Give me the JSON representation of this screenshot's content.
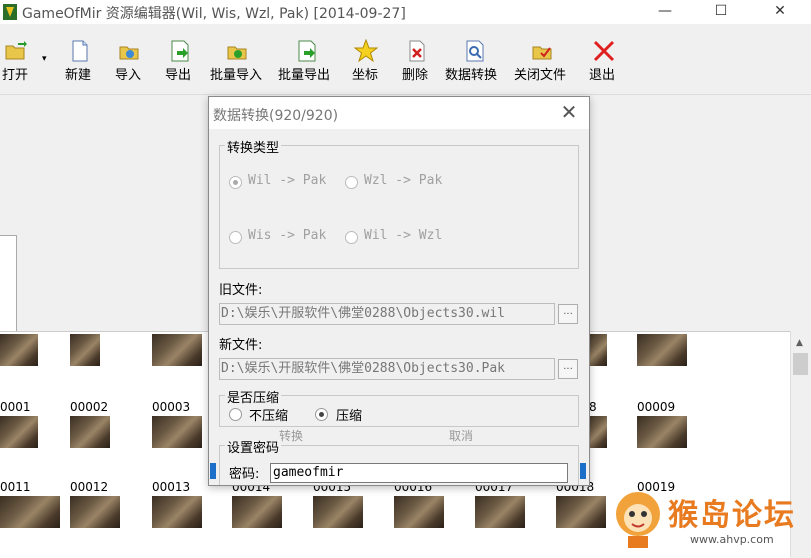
{
  "window": {
    "title": "GameOfMir 资源编辑器(Wil, Wis, Wzl, Pak) [2014-09-27]",
    "minimize": "—",
    "maximize": "☐",
    "close": "✕"
  },
  "toolbar": {
    "open": "打开",
    "open_arrow": "▾",
    "new": "新建",
    "import": "导入",
    "export": "导出",
    "batch_import": "批量导入",
    "batch_export": "批量导出",
    "coords": "坐标",
    "delete": "删除",
    "data_convert": "数据转换",
    "close_file": "关闭文件",
    "exit": "退出"
  },
  "tiles": {
    "row1": [
      "0001",
      "00002",
      "00003",
      "8",
      "00009"
    ],
    "row2": [
      "0011",
      "00012",
      "00013",
      "00014",
      "00015",
      "00016",
      "00017",
      "00018",
      "00019"
    ]
  },
  "dialog": {
    "title": "数据转换(920/920)",
    "close": "✕",
    "convert_type_label": "转换类型",
    "options": [
      "Wil -> Pak",
      "Wzl -> Pak",
      "Wis -> Pak",
      "Wil -> Wzl"
    ],
    "selected_option": "Wil -> Pak",
    "old_file_label": "旧文件:",
    "old_file_value": "D:\\娱乐\\开服软件\\佛堂0288\\Objects30.wil",
    "new_file_label": "新文件:",
    "new_file_value": "D:\\娱乐\\开服软件\\佛堂0288\\Objects30.Pak",
    "browse": "...",
    "compress_label": "是否压缩",
    "no_compress": "不压缩",
    "compress": "压缩",
    "compress_selected": "压缩",
    "convert_button": "转换",
    "cancel_button": "取消",
    "password_group": "设置密码",
    "password_label": "密码:",
    "password_value": "gameofmir"
  },
  "watermark": {
    "text": "猴岛论坛",
    "url": "www.ahvp.com"
  }
}
